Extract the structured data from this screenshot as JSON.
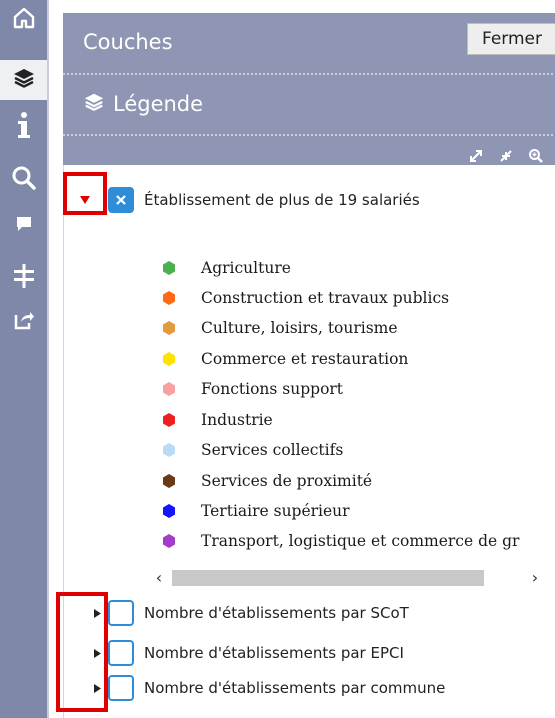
{
  "toolbar": {
    "items": [
      {
        "icon": "home-icon"
      },
      {
        "icon": "layers-icon",
        "active": true
      },
      {
        "icon": "info-icon"
      },
      {
        "icon": "search-icon"
      },
      {
        "icon": "comment-icon"
      },
      {
        "icon": "measure-icon"
      },
      {
        "icon": "share-icon"
      }
    ]
  },
  "panel": {
    "title": "Couches",
    "close_label": "Fermer",
    "legend_title": "Légende"
  },
  "layers": [
    {
      "label": "Établissement de plus de 19 salariés",
      "checked": true,
      "expanded": true,
      "legend": [
        {
          "label": "Agriculture",
          "color": "#4caf50"
        },
        {
          "label": "Construction et travaux publics",
          "color": "#ff6a13"
        },
        {
          "label": "Culture, loisirs, tourisme",
          "color": "#e39a3b"
        },
        {
          "label": "Commerce et restauration",
          "color": "#ffe200"
        },
        {
          "label": "Fonctions support",
          "color": "#f7a1a1"
        },
        {
          "label": "Industrie",
          "color": "#f01e1e"
        },
        {
          "label": "Services collectifs",
          "color": "#b9dbf5"
        },
        {
          "label": "Services de proximité",
          "color": "#6b3a14"
        },
        {
          "label": "Tertiaire supérieur",
          "color": "#1414ff"
        },
        {
          "label": "Transport, logistique et commerce de gr",
          "color": "#a23ccb"
        }
      ]
    },
    {
      "label": "Nombre d'établissements par SCoT",
      "checked": false,
      "expanded": false
    },
    {
      "label": "Nombre d'établissements par EPCI",
      "checked": false,
      "expanded": false
    },
    {
      "label": "Nombre d'établissements par commune",
      "checked": false,
      "expanded": false
    }
  ],
  "colors": {
    "toolbar_bg": "#7f88a8",
    "panel_head_bg": "#8e96b3",
    "checkbox_blue": "#2f8dd8",
    "highlight_red": "#e00000"
  }
}
